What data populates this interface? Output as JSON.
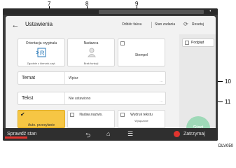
{
  "callouts": [
    "7",
    "8",
    "9",
    "10",
    "11"
  ],
  "header": {
    "title": "Ustawienia",
    "link_original_type": "Odbiór faksu",
    "link_scan_status": "Stan zadania",
    "link_reset": "Resetuj"
  },
  "cards": {
    "orientation": {
      "title": "Orientacja oryginału",
      "sub": "Zgodnie z kierunk.czyt.",
      "icon": "orientation-r-icon"
    },
    "sender": {
      "title": "Nadawca",
      "sub": "Brak funkcji"
    },
    "stamp": {
      "title": "Stempel"
    },
    "auto": {
      "title": "Auto. przesyłanie"
    },
    "sender_name": {
      "title": "Nadaw.nazwis."
    },
    "print_text": {
      "title": "Wydruk tekstu",
      "sub": "Wyłączone"
    }
  },
  "rows": {
    "subject": {
      "label": "Temat",
      "value": "Wpisz"
    },
    "text": {
      "label": "Tekst",
      "value": "Nie ustawiono"
    }
  },
  "right_pane": {
    "preview_label": "Podgląd",
    "start_label": "Start"
  },
  "bottom_bar": {
    "check_status": "Sprawdź stan",
    "stop": "Zatrzymaj"
  },
  "figure_id": "DLV050"
}
